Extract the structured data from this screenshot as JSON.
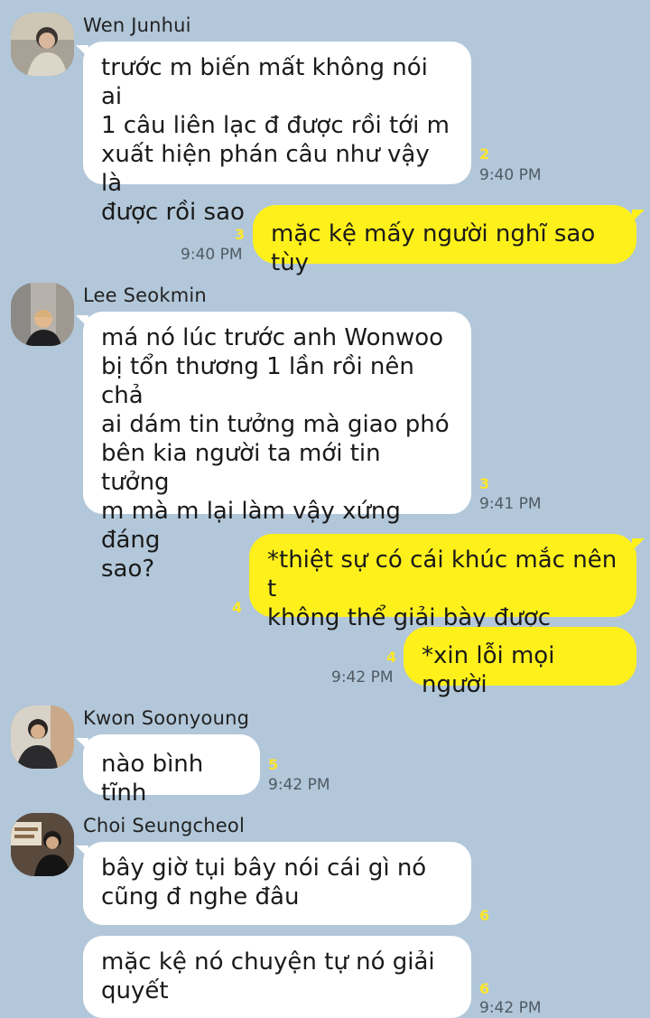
{
  "colors": {
    "background": "#b2c7d9",
    "incoming_bubble": "#ffffff",
    "outgoing_bubble": "#fef01b",
    "unread_count": "#fde62b",
    "timestamp": "#4f5a63"
  },
  "messages": {
    "m1": {
      "sender": "Wen Junhui",
      "avatar": "avatar-photo",
      "text": "trước m biến mất không nói ai\n1 câu liên lạc đ được rồi tới m\nxuất hiện phán câu như vậy là\nđược rồi sao",
      "unread": "2",
      "time": "9:40 PM"
    },
    "m2": {
      "text": "mặc kệ mấy người nghĩ sao tùy",
      "unread": "3",
      "time": "9:40 PM"
    },
    "m3": {
      "sender": "Lee Seokmin",
      "avatar": "avatar-photo",
      "text": "má nó lúc trước anh Wonwoo\nbị tổn thương 1 lần rồi nên chả\nai dám tin tưởng mà giao phó\nbên kia người ta mới tin tưởng\nm mà m lại làm vậy xứng đáng\nsao?",
      "unread": "3",
      "time": "9:41 PM"
    },
    "m4": {
      "text": "*thiệt sự có cái khúc mắc nên t\nkhông thể giải bày được",
      "unread": "4"
    },
    "m5": {
      "text": "*xin lỗi mọi người",
      "unread": "4",
      "time": "9:42 PM"
    },
    "m6": {
      "sender": "Kwon Soonyoung",
      "avatar": "avatar-photo",
      "text": "nào bình tĩnh",
      "unread": "5",
      "time": "9:42 PM"
    },
    "m7": {
      "sender": "Choi Seungcheol",
      "avatar": "avatar-photo",
      "text": "bây giờ tụi bây nói cái gì nó\ncũng đ nghe đâu",
      "unread": "6"
    },
    "m8": {
      "text": "mặc kệ nó chuyện tự nó giải\nquyết",
      "unread": "6",
      "time": "9:42 PM"
    }
  }
}
